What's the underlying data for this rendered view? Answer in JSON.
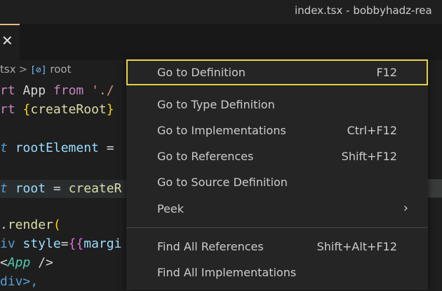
{
  "window": {
    "title": "index.tsx - bobbyhadz-rea"
  },
  "tab": {
    "close_glyph": "✕"
  },
  "breadcrumb": {
    "file": "tsx",
    "separator": ">",
    "symbol_glyph": "[⊘]",
    "symbol": "root"
  },
  "editor": {
    "lines": [
      [
        "rt",
        "App",
        "from",
        "'./"
      ],
      [
        "rt",
        "{",
        "createRoot",
        "}"
      ],
      [],
      [
        "t",
        "rootElement",
        "="
      ],
      [],
      [
        "t",
        "root",
        "=",
        "createR"
      ],
      [],
      [
        ".",
        "render",
        "("
      ],
      [
        "iv",
        "style",
        "=",
        "{{",
        "margi"
      ],
      [
        "<",
        "App",
        "/>"
      ],
      [
        "div>,"
      ]
    ]
  },
  "context_menu": {
    "items": [
      {
        "label": "Go to Definition",
        "shortcut": "F12"
      },
      {
        "label": "Go to Type Definition",
        "shortcut": ""
      },
      {
        "label": "Go to Implementations",
        "shortcut": "Ctrl+F12"
      },
      {
        "label": "Go to References",
        "shortcut": "Shift+F12"
      },
      {
        "label": "Go to Source Definition",
        "shortcut": ""
      },
      {
        "label": "Peek",
        "shortcut": "",
        "submenu_glyph": "›"
      },
      {
        "label": "Find All References",
        "shortcut": "Shift+Alt+F12"
      },
      {
        "label": "Find All Implementations",
        "shortcut": ""
      }
    ]
  },
  "colors": {
    "focus_outline": "#e5d04b",
    "menu_bg": "#252526",
    "editor_bg": "#1e1e1e"
  }
}
